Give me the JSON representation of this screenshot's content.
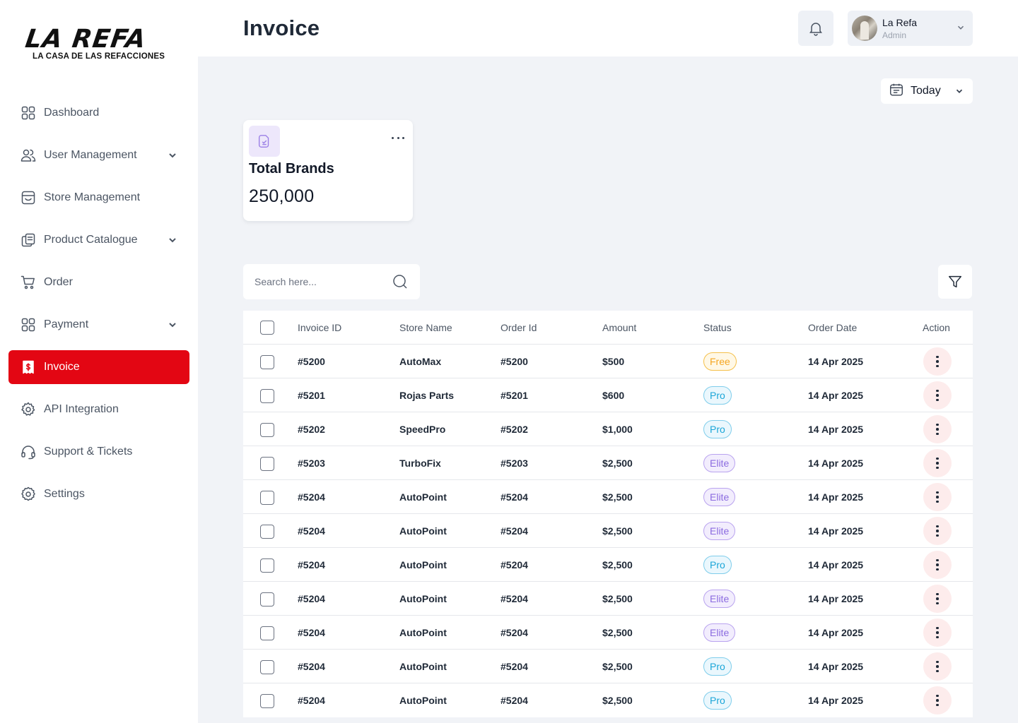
{
  "brand": {
    "logo_text": "LA REFA",
    "logo_subtitle": "LA CASA DE LAS REFACCIONES",
    "accent_color": "#E30613"
  },
  "sidebar": {
    "items": [
      {
        "label": "Dashboard",
        "icon": "grid-icon",
        "has_chevron": false,
        "active": false
      },
      {
        "label": "User Management",
        "icon": "users-icon",
        "has_chevron": true,
        "active": false
      },
      {
        "label": "Store Management",
        "icon": "store-icon",
        "has_chevron": false,
        "active": false
      },
      {
        "label": "Product Catalogue",
        "icon": "catalogue-icon",
        "has_chevron": true,
        "active": false
      },
      {
        "label": "Order",
        "icon": "cart-icon",
        "has_chevron": false,
        "active": false
      },
      {
        "label": "Payment",
        "icon": "grid-icon",
        "has_chevron": true,
        "active": false
      },
      {
        "label": "Invoice",
        "icon": "invoice-icon",
        "has_chevron": false,
        "active": true
      },
      {
        "label": "API Integration",
        "icon": "gears-icon",
        "has_chevron": false,
        "active": false
      },
      {
        "label": "Support & Tickets",
        "icon": "headset-icon",
        "has_chevron": false,
        "active": false
      },
      {
        "label": "Settings",
        "icon": "gear-icon",
        "has_chevron": false,
        "active": false
      }
    ]
  },
  "header": {
    "title": "Invoice",
    "user": {
      "name": "La Refa",
      "role": "Admin"
    }
  },
  "date_filter": {
    "label": "Today"
  },
  "stat_card": {
    "label": "Total Brands",
    "value": "250,000"
  },
  "search": {
    "placeholder": "Search here...",
    "value": ""
  },
  "table": {
    "columns": [
      "Invoice ID",
      "Store Name",
      "Order Id",
      "Amount",
      "Status",
      "Order Date",
      "Action"
    ],
    "rows": [
      {
        "invoice_id": "#5200",
        "store": "AutoMax",
        "order_id": "#5200",
        "amount": "$500",
        "status": "Free",
        "date": "14 Apr 2025"
      },
      {
        "invoice_id": "#5201",
        "store": "Rojas Parts",
        "order_id": "#5201",
        "amount": "$600",
        "status": "Pro",
        "date": "14 Apr 2025"
      },
      {
        "invoice_id": "#5202",
        "store": "SpeedPro",
        "order_id": "#5202",
        "amount": "$1,000",
        "status": "Pro",
        "date": "14 Apr 2025"
      },
      {
        "invoice_id": "#5203",
        "store": "TurboFix",
        "order_id": "#5203",
        "amount": "$2,500",
        "status": "Elite",
        "date": "14 Apr 2025"
      },
      {
        "invoice_id": "#5204",
        "store": "AutoPoint",
        "order_id": "#5204",
        "amount": "$2,500",
        "status": "Elite",
        "date": "14 Apr 2025"
      },
      {
        "invoice_id": "#5204",
        "store": "AutoPoint",
        "order_id": "#5204",
        "amount": "$2,500",
        "status": "Elite",
        "date": "14 Apr 2025"
      },
      {
        "invoice_id": "#5204",
        "store": "AutoPoint",
        "order_id": "#5204",
        "amount": "$2,500",
        "status": "Pro",
        "date": "14 Apr 2025"
      },
      {
        "invoice_id": "#5204",
        "store": "AutoPoint",
        "order_id": "#5204",
        "amount": "$2,500",
        "status": "Elite",
        "date": "14 Apr 2025"
      },
      {
        "invoice_id": "#5204",
        "store": "AutoPoint",
        "order_id": "#5204",
        "amount": "$2,500",
        "status": "Elite",
        "date": "14 Apr 2025"
      },
      {
        "invoice_id": "#5204",
        "store": "AutoPoint",
        "order_id": "#5204",
        "amount": "$2,500",
        "status": "Pro",
        "date": "14 Apr 2025"
      },
      {
        "invoice_id": "#5204",
        "store": "AutoPoint",
        "order_id": "#5204",
        "amount": "$2,500",
        "status": "Pro",
        "date": "14 Apr 2025"
      }
    ]
  }
}
